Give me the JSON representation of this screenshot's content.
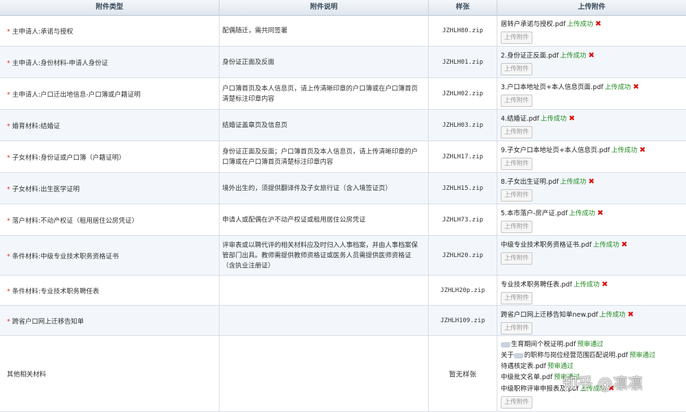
{
  "header": {
    "col_type": "附件类型",
    "col_desc": "附件说明",
    "col_sample": "样张",
    "col_upload": "上传附件"
  },
  "upload_button_label": "上传附件",
  "rows": [
    {
      "type": "主申请人:承诺与授权",
      "desc": "配偶随迁，需共同签署",
      "sample": "JZHLH80.zip",
      "files": [
        {
          "name": "居转户承诺与授权.pdf",
          "status": "上传成功",
          "delete_icon": "✖"
        }
      ]
    },
    {
      "type": "主申请人:身份材料-申请人身份证",
      "desc": "身份证正面及反面",
      "sample": "JZHLH01.zip",
      "files": [
        {
          "name": "2.身份证正反面.pdf",
          "status": "上传成功",
          "delete_icon": "✖"
        }
      ]
    },
    {
      "type": "主申请人:户口迁出地信息-户口簿或户籍证明",
      "desc": "户口簿首页及本人信息页，请上传清晰印章的户口簿或在户口簿首页清楚标注印章内容",
      "sample": "JZHLH02.zip",
      "files": [
        {
          "name": "3.户口本地址页+本人信息页面.pdf",
          "status": "上传成功",
          "delete_icon": "✖"
        }
      ]
    },
    {
      "type": "婚育材料:结婚证",
      "desc": "结婚证盖章页及信息页",
      "sample": "JZHLH03.zip",
      "files": [
        {
          "name": "4.结婚证.pdf",
          "status": "上传成功",
          "delete_icon": "✖"
        }
      ]
    },
    {
      "type": "子女材料:身份证或户口簿（户籍证明）",
      "desc": "身份证正面及反面；户口簿首页及本人信息页，请上传清晰印章的户口簿或在户口簿首页清楚标注印章内容",
      "sample": "JZHLH17.zip",
      "files": [
        {
          "name": "9.子女户口本地址页+本人信息页.pdf",
          "status": "上传成功",
          "delete_icon": "✖"
        }
      ]
    },
    {
      "type": "子女材料:出生医学证明",
      "desc": "境外出生的，须提供翻译件及子女旅行证（含入境签证页）",
      "sample": "JZHLH15.zip",
      "files": [
        {
          "name": "8.子女出生证明.pdf",
          "status": "上传成功",
          "delete_icon": "✖"
        }
      ]
    },
    {
      "type": "落户材料:不动产权证（租用居住公房凭证）",
      "desc": "申请人或配偶在沪不动产权证或租用居住公房凭证",
      "sample": "JZHLH73.zip",
      "files": [
        {
          "name": "5.本市落户-房产证.pdf",
          "status": "上传成功",
          "delete_icon": "✖"
        }
      ]
    },
    {
      "type": "条件材料:中级专业技术职务资格证书",
      "desc": "评审表或以聘代评的相关材料应及时归入人事档案，并由人事档案保管部门出具。教师需提供教师资格证或医务人员需提供医师资格证（含执业注册证）",
      "sample": "JZHLH20.zip",
      "files": [
        {
          "name": "中级专业技术职务资格证书.pdf",
          "status": "上传成功",
          "delete_icon": "✖"
        }
      ]
    },
    {
      "type": "条件材料:专业技术职务聘任表",
      "desc": "",
      "sample": "JZHLH20p.zip",
      "files": [
        {
          "name": "专业技术职务聘任表.pdf",
          "status": "上传成功",
          "delete_icon": "✖"
        }
      ]
    },
    {
      "type": "跨省户口网上迁移告知单",
      "desc": "",
      "sample": "JZHLH109.zip",
      "files": [
        {
          "name": "跨省户口网上迁移告知单new.pdf",
          "status": "上传成功",
          "delete_icon": "✖"
        }
      ]
    },
    {
      "type": "其他相关材料",
      "desc": "",
      "sample": "暂无样张",
      "files": [
        {
          "prefix": "",
          "name": "生育期间个税证明.pdf",
          "status": "预审通过",
          "delete_icon": ""
        },
        {
          "prefix": "关于",
          "name": "的职称与岗位经营范围匹配说明.pdf",
          "status": "预审通过",
          "delete_icon": ""
        },
        {
          "prefix": "",
          "name": "待遇核定表.pdf",
          "status": "预审通过",
          "delete_icon": ""
        },
        {
          "prefix": "",
          "name": "中级批文名单.pdf",
          "status": "预审通过",
          "delete_icon": ""
        },
        {
          "prefix": "",
          "name": "中级职称评审申报表及.pdf",
          "status": "上传成功",
          "delete_icon": "✖"
        }
      ]
    }
  ],
  "required_mark": "*",
  "watermark": "知乎 @凛凛",
  "colors": {
    "success": "#218a21",
    "delete": "#d11111",
    "required": "#dd3333",
    "alt_row": "#f3f7fb"
  }
}
